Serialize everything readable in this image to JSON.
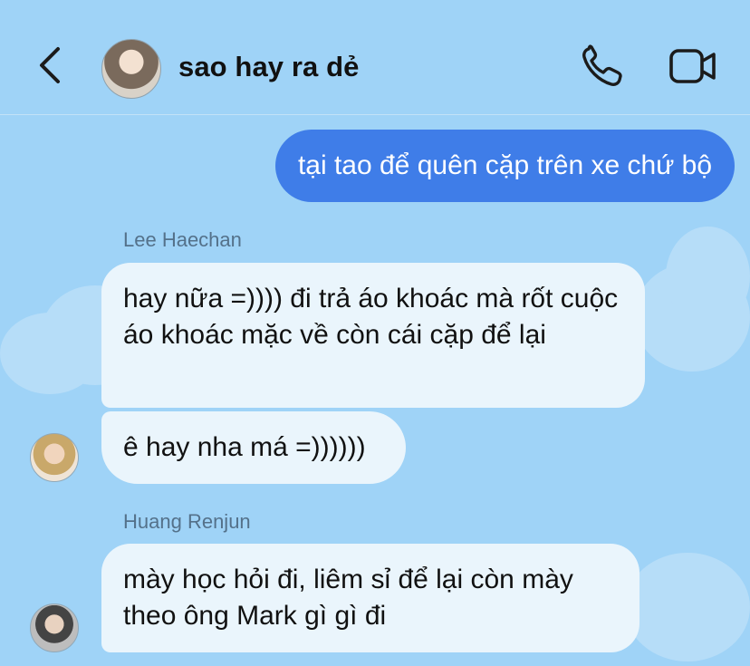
{
  "header": {
    "title": "sao hay ra dẻ",
    "back_icon": "chevron-left-icon",
    "call_icon": "phone-icon",
    "video_icon": "video-camera-icon"
  },
  "messages": [
    {
      "direction": "outgoing",
      "text": "tại tao để quên cặp trên xe chứ bộ"
    },
    {
      "direction": "incoming",
      "sender": "Lee Haechan",
      "text": "hay nữa =)))) đi trả áo khoác mà rốt cuộc áo khoác mặc về còn cái cặp để lại"
    },
    {
      "direction": "incoming",
      "text": "ê hay nha má =))))))"
    },
    {
      "direction": "incoming",
      "sender": "Huang Renjun",
      "text": "mày học hỏi đi, liêm sỉ để lại còn mày theo ông Mark gì gì đi"
    }
  ],
  "colors": {
    "background": "#9fd3f7",
    "outgoing_bubble": "#3f7de8",
    "incoming_bubble": "#eaf5fc",
    "sender_label": "#54718a"
  }
}
